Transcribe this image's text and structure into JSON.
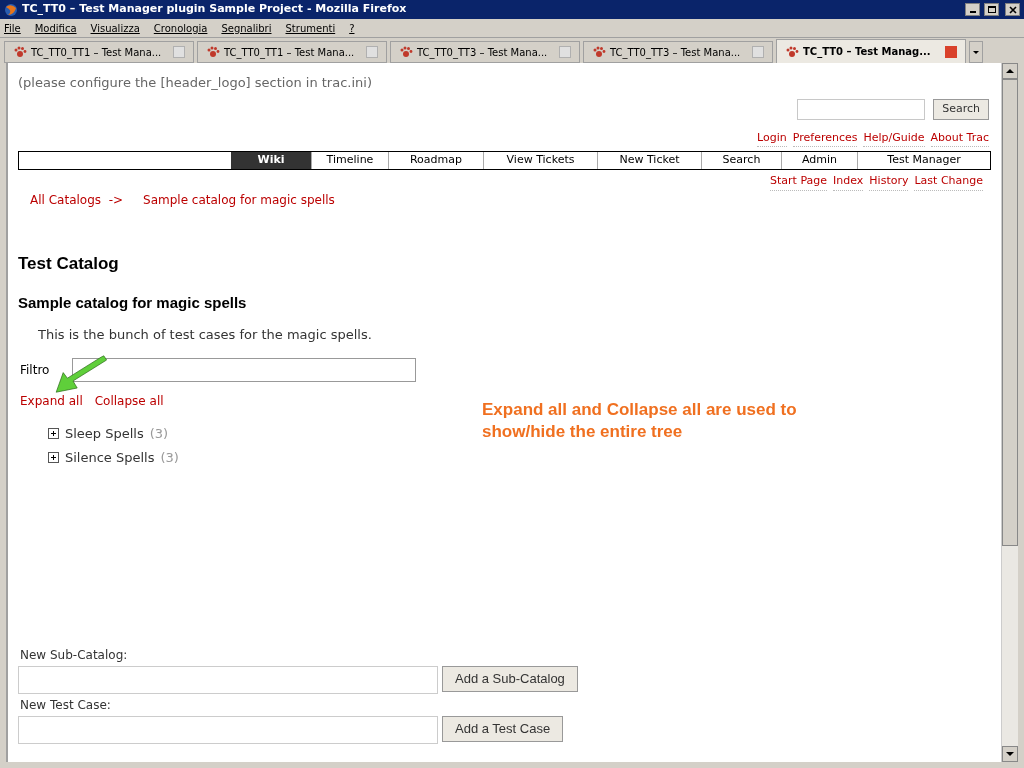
{
  "window": {
    "title": "TC_TT0 – Test Manager plugin Sample Project - Mozilla Firefox"
  },
  "menu": [
    {
      "label": "File"
    },
    {
      "label": "Modifica"
    },
    {
      "label": "Visualizza"
    },
    {
      "label": "Cronologia"
    },
    {
      "label": "Segnalibri"
    },
    {
      "label": "Strumenti"
    },
    {
      "label": "?"
    }
  ],
  "tabs": [
    {
      "label": "TC_TT0_TT1 – Test Mana...",
      "selected": false
    },
    {
      "label": "TC_TT0_TT1 – Test Mana...",
      "selected": false
    },
    {
      "label": "TC_TT0_TT3 – Test Mana...",
      "selected": false
    },
    {
      "label": "TC_TT0_TT3 – Test Mana...",
      "selected": false
    },
    {
      "label": "TC_TT0 – Test Manag...",
      "selected": true
    }
  ],
  "header_note": "(please configure the [header_logo] section in trac.ini)",
  "search": {
    "button": "Search"
  },
  "meta_nav": [
    "Login",
    "Preferences",
    "Help/Guide",
    "About Trac"
  ],
  "main_nav": [
    {
      "label": "Wiki",
      "selected": true
    },
    {
      "label": "Timeline",
      "selected": false
    },
    {
      "label": "Roadmap",
      "selected": false
    },
    {
      "label": "View Tickets",
      "selected": false
    },
    {
      "label": "New Ticket",
      "selected": false
    },
    {
      "label": "Search",
      "selected": false
    },
    {
      "label": "Admin",
      "selected": false
    },
    {
      "label": "Test Manager",
      "selected": false
    }
  ],
  "context_nav": [
    "Start Page",
    "Index",
    "History",
    "Last Change"
  ],
  "breadcrumb": [
    "All Catalogs  ->",
    "Sample catalog for magic spells"
  ],
  "heading": "Test Catalog",
  "subheading": "Sample catalog for magic spells",
  "description": "This is the bunch of test cases for the magic spells.",
  "filter_label": "Filtro",
  "tree_links": [
    "Expand all",
    "Collapse all"
  ],
  "tree": [
    {
      "label": "Sleep Spells",
      "count": "(3)",
      "expanded": false
    },
    {
      "label": "Silence Spells",
      "count": "(3)",
      "expanded": false
    }
  ],
  "annotation": "Expand all and Collapse all are used to show/hide the entire tree",
  "forms": [
    {
      "label": "New Sub-Catalog:",
      "button": "Add a Sub-Catalog"
    },
    {
      "label": "New Test Case:",
      "button": "Add a Test Case"
    }
  ]
}
